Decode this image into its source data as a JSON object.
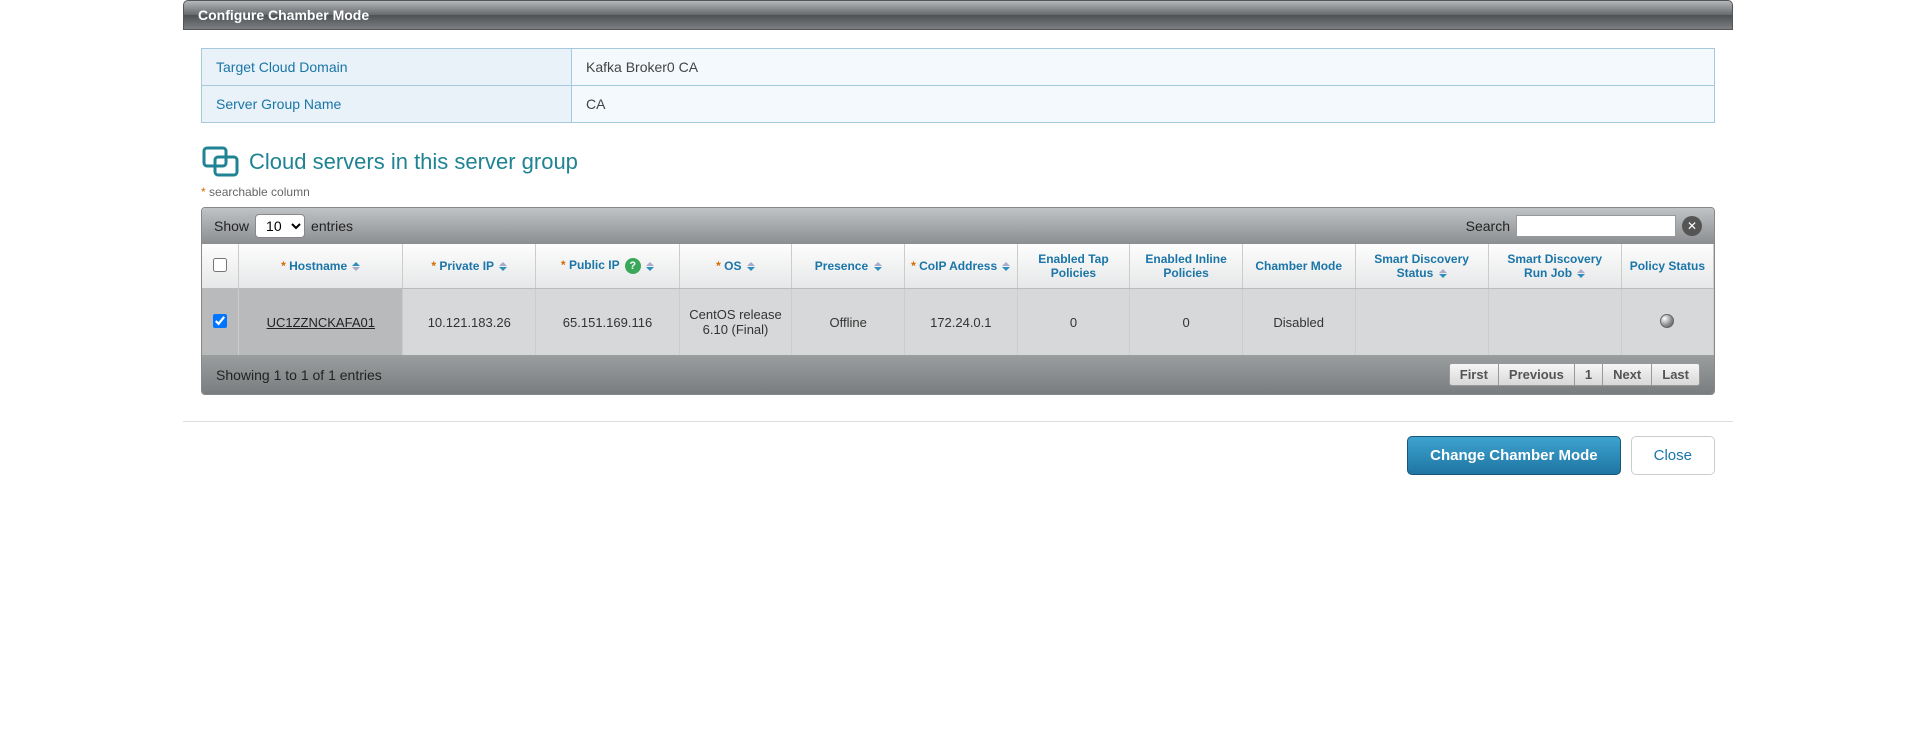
{
  "header": {
    "title": "Configure Chamber Mode"
  },
  "info": {
    "target_domain_label": "Target Cloud Domain",
    "target_domain_value": "Kafka Broker0 CA",
    "server_group_label": "Server Group Name",
    "server_group_value": "CA"
  },
  "section": {
    "title": "Cloud servers in this server group",
    "hint_prefix": "* ",
    "hint_text": "searchable column"
  },
  "toolbar": {
    "show_label": "Show",
    "entries_label": "entries",
    "entries_value": "10",
    "search_label": "Search"
  },
  "columns": {
    "hostname": "Hostname",
    "private_ip": "Private IP",
    "public_ip": "Public IP",
    "os": "OS",
    "presence": "Presence",
    "coip": "CoIP Address",
    "tap": "Enabled Tap Policies",
    "inline": "Enabled Inline Policies",
    "chamber": "Chamber Mode",
    "disc_status": "Smart Discovery Status",
    "disc_job": "Smart Discovery Run Job",
    "policy_status": "Policy Status"
  },
  "rows": [
    {
      "checked": true,
      "hostname": "UC1ZZNCKAFA01",
      "private_ip": "10.121.183.26",
      "public_ip": "65.151.169.116",
      "os": "CentOS release 6.10 (Final)",
      "presence": "Offline",
      "coip": "172.24.0.1",
      "tap": "0",
      "inline": "0",
      "chamber": "Disabled",
      "disc_status": "",
      "disc_job": "",
      "policy_status": "offline"
    }
  ],
  "footer": {
    "info": "Showing 1 to 1 of 1 entries",
    "first": "First",
    "prev": "Previous",
    "page": "1",
    "next": "Next",
    "last": "Last"
  },
  "actions": {
    "primary": "Change Chamber Mode",
    "close": "Close"
  }
}
